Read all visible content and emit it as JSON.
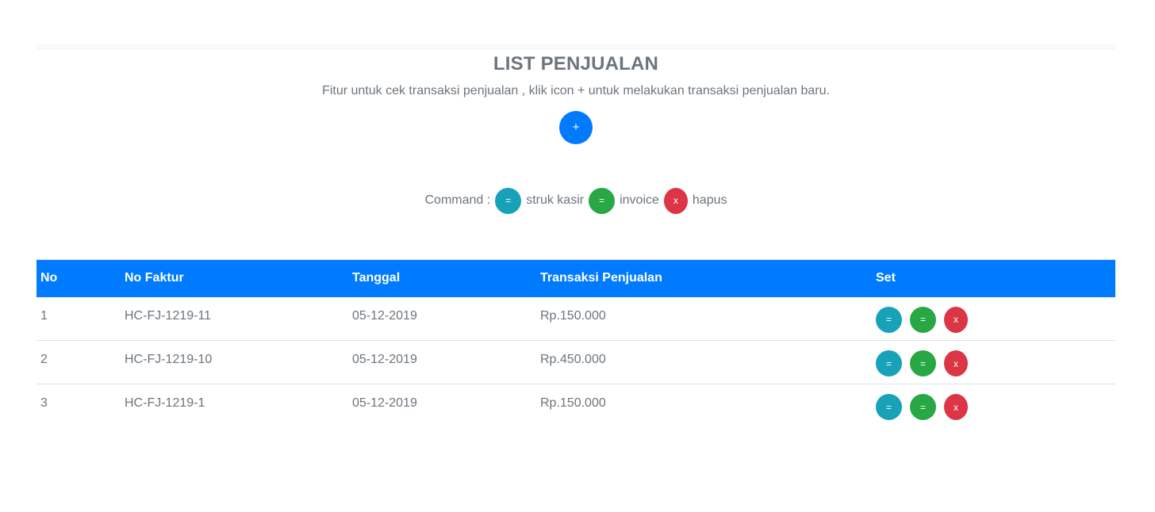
{
  "header": {
    "title": "LIST PENJUALAN",
    "subtitle": "Fitur untuk cek transaksi penjualan , klik icon + untuk melakukan transaksi penjualan baru.",
    "add_button_label": "+"
  },
  "commands": {
    "label": "Command :",
    "items": [
      {
        "icon": "=",
        "label": "struk kasir",
        "color": "#17a2b8"
      },
      {
        "icon": "=",
        "label": "invoice",
        "color": "#28a745"
      },
      {
        "icon": "x",
        "label": "hapus",
        "color": "#dc3545"
      }
    ]
  },
  "colors": {
    "primary": "#007bff",
    "info": "#17a2b8",
    "success": "#28a745",
    "danger": "#dc3545",
    "muted_text": "#6c757d"
  },
  "table": {
    "columns": [
      "No",
      "No Faktur",
      "Tanggal",
      "Transaksi Penjualan",
      "Set"
    ],
    "rows": [
      {
        "no": "1",
        "faktur": "HC-FJ-1219-11",
        "tanggal": "05-12-2019",
        "transaksi": "Rp.150.000",
        "actions": [
          "=",
          "=",
          "x"
        ]
      },
      {
        "no": "2",
        "faktur": "HC-FJ-1219-10",
        "tanggal": "05-12-2019",
        "transaksi": "Rp.450.000",
        "actions": [
          "=",
          "=",
          "x"
        ]
      },
      {
        "no": "3",
        "faktur": "HC-FJ-1219-1",
        "tanggal": "05-12-2019",
        "transaksi": "Rp.150.000",
        "actions": [
          "=",
          "=",
          "x"
        ]
      }
    ]
  }
}
